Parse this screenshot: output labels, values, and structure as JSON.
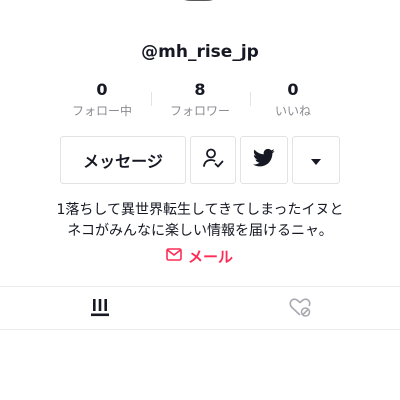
{
  "profile": {
    "username": "@mh_rise_jp"
  },
  "stats": [
    {
      "value": "0",
      "label": "フォロー中"
    },
    {
      "value": "8",
      "label": "フォロワー"
    },
    {
      "value": "0",
      "label": "いいね"
    }
  ],
  "actions": {
    "message_label": "メッセージ",
    "follow_icon": "person-check-icon",
    "twitter_icon": "twitter-icon",
    "more_icon": "triangle-down-icon"
  },
  "bio": {
    "line1": "1落ちして異世界転生してきてしまったイヌと",
    "line2": "ネコがみんなに楽しい情報を届けるニャ。"
  },
  "mail": {
    "label": "メール",
    "icon": "mail-icon"
  },
  "tabs": [
    {
      "icon": "videos-grid-icon"
    },
    {
      "icon": "liked-heart-icon"
    }
  ],
  "colors": {
    "accent": "#fe2c55",
    "text": "#161823",
    "muted": "#8a8b91",
    "border": "#e3e3e4"
  }
}
